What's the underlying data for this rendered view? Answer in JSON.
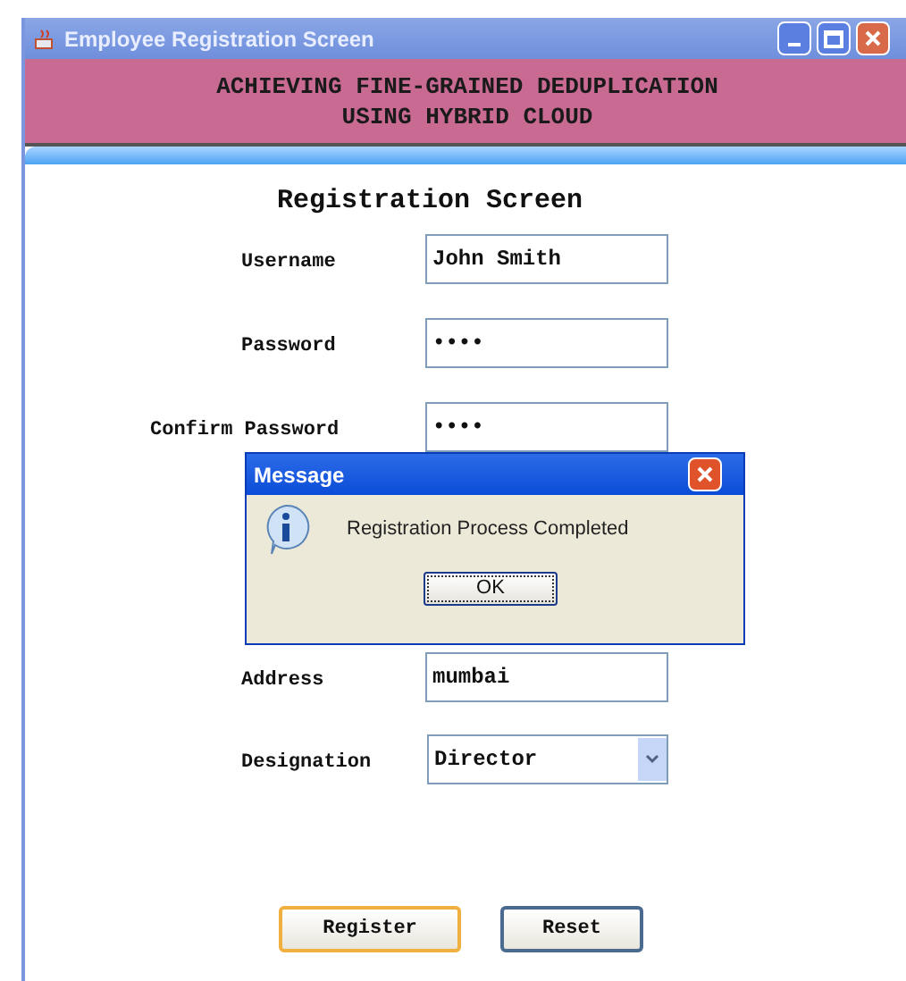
{
  "window": {
    "title": "Employee Registration Screen"
  },
  "banner": [
    "ACHIEVING FINE-GRAINED DEDUPLICATION",
    "USING HYBRID CLOUD"
  ],
  "form": {
    "heading": "Registration Screen",
    "fields": [
      {
        "label": "Username",
        "kind": "text",
        "value": "John Smith"
      },
      {
        "label": "Password",
        "kind": "text",
        "value": "••••"
      },
      {
        "label": "Confirm Password",
        "kind": "text",
        "value": "••••"
      },
      {
        "label": "Address",
        "kind": "text",
        "value": "mumbai"
      },
      {
        "label": "Designation",
        "kind": "select",
        "value": "Director"
      }
    ],
    "buttons": [
      {
        "label": "Register",
        "focused": true
      },
      {
        "label": "Reset",
        "focused": false
      }
    ]
  },
  "dialog": {
    "title": "Message",
    "message": "Registration Process Completed",
    "button": "OK"
  }
}
